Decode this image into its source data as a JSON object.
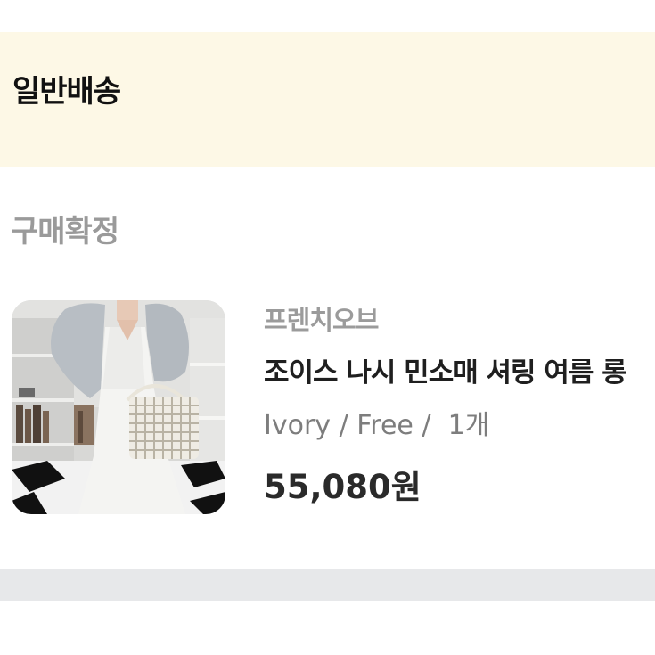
{
  "shipping": {
    "title": "일반배송"
  },
  "order": {
    "status": "구매확정",
    "item": {
      "seller": "프렌치오브",
      "name": "조이스 나시 민소매 셔링 여름 롱",
      "options": "Ivory / Free /  1개",
      "price": "55,080원"
    }
  }
}
